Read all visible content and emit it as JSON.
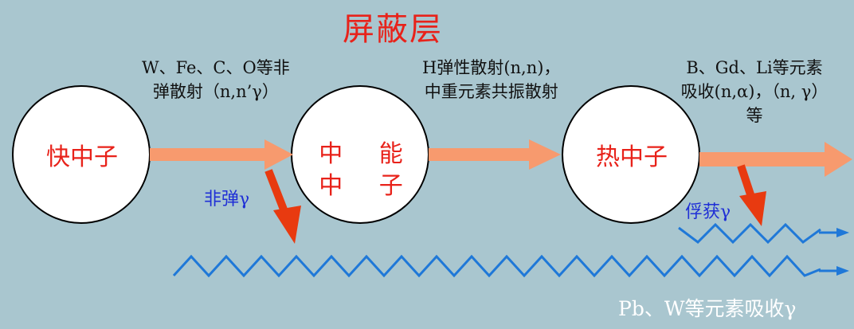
{
  "title": "屏蔽层",
  "processes": {
    "fast_to_mid": {
      "line1": "W、Fe、C、O等非",
      "line2": "弹散射（n,n’γ）"
    },
    "mid_to_thermal": {
      "line1": "H弹性散射(n,n)，",
      "line2": "中重元素共振散射"
    },
    "thermal": {
      "line1": "B、Gd、Li等元素",
      "line2": "吸收(n,α)，（n, γ）",
      "line3": "等"
    }
  },
  "stages": {
    "fast": "快中子",
    "intermediate": "中 能 中 子",
    "thermal": "热中子"
  },
  "gammas": {
    "inelastic": "非弹γ",
    "capture": "俘获γ"
  },
  "absorption": "Pb、W等元素吸收γ",
  "colors": {
    "background": "#a9c6cf",
    "circle_fill": "#ffffff",
    "stage_text": "#e8221a",
    "flow_arrow": "#f79a6e",
    "gamma_arrow": "#e83a10",
    "gamma_wave": "#1f78d8",
    "gamma_label": "#1f2fd6"
  }
}
